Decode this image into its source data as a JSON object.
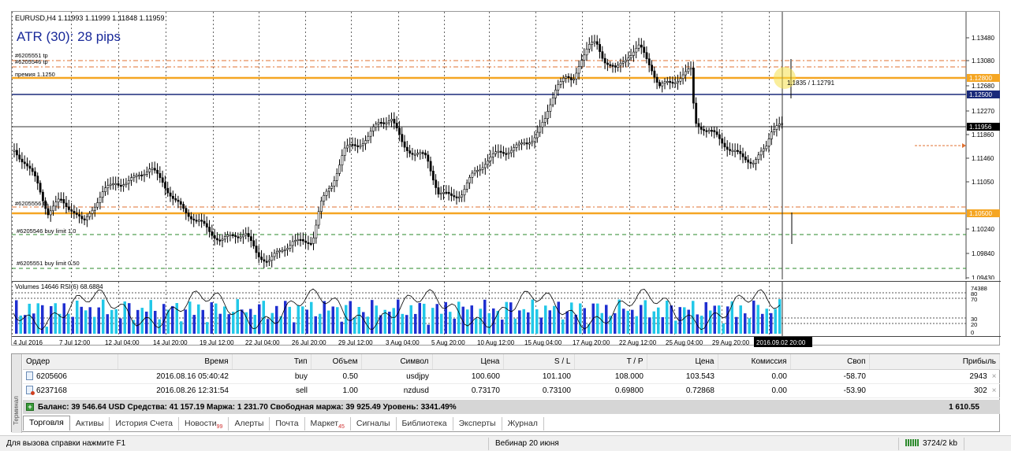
{
  "chart": {
    "header": "EURUSD,H4  1.11993 1.11999 1.11848 1.11959",
    "atr_label": "ATR (30): 28 pips",
    "volumes_header": "Volumes 14646  RSI(6) 68.6884",
    "current_price": "1.11956",
    "crosshair_label": "1.1835 / 1.12791",
    "time_marker": "2016.09.02 20:00",
    "price_ticks": [
      "1.13480",
      "1.13080",
      "1.12680",
      "1.12270",
      "1.11860",
      "1.11460",
      "1.11050",
      "1.10240",
      "1.09840",
      "1.09430"
    ],
    "highlighted_price_ticks": [
      {
        "value": "1.12800",
        "color": "#f5a623"
      },
      {
        "value": "1.12500",
        "color": "#1a2a7a"
      },
      {
        "value": "1.10500",
        "color": "#f5a623"
      }
    ],
    "order_labels": {
      "tp1": "#6205551 tp",
      "tp2": "#6205546 tp",
      "premium": "премия 1.1250",
      "tp3": "#6205556 tp",
      "buy_limit1": "#6205546 buy limit 1.0",
      "buy_limit2": "#6205551 buy limit 0.50"
    },
    "indicator_ticks": [
      "74388",
      "80",
      "70",
      "30",
      "20",
      "0"
    ],
    "time_labels": [
      "4 Jul 2016",
      "7 Jul 12:00",
      "12 Jul 04:00",
      "14 Jul 20:00",
      "19 Jul 12:00",
      "22 Jul 04:00",
      "26 Jul 20:00",
      "29 Jul 12:00",
      "3 Aug 04:00",
      "5 Aug 20:00",
      "10 Aug 12:00",
      "15 Aug 04:00",
      "17 Aug 20:00",
      "22 Aug 12:00",
      "25 Aug 04:00",
      "29 Aug 20:00"
    ],
    "colors": {
      "orange_line": "#f5a623",
      "navy_line": "#1a2a7a",
      "volume_blue": "#1f2fd0",
      "volume_cyan": "#22c8e8",
      "atr_text": "#1a2a9a"
    }
  },
  "terminal": {
    "side_label": "Терминал",
    "columns": [
      "Ордер",
      "Время",
      "Тип",
      "Объем",
      "Символ",
      "Цена",
      "S / L",
      "T / P",
      "Цена",
      "Комиссия",
      "Своп",
      "Прибыль"
    ],
    "rows": [
      {
        "order": "6205606",
        "time": "2016.08.16 05:40:42",
        "type": "buy",
        "volume": "0.50",
        "symbol": "usdjpy",
        "price": "100.600",
        "sl": "101.100",
        "tp": "108.000",
        "cur_price": "103.543",
        "commission": "0.00",
        "swap": "-58.70",
        "profit": "2943",
        "icon": "order-icon"
      },
      {
        "order": "6237168",
        "time": "2016.08.26 12:31:54",
        "type": "sell",
        "volume": "1.00",
        "symbol": "nzdusd",
        "price": "0.73170",
        "sl": "0.73100",
        "tp": "0.69800",
        "cur_price": "0.72868",
        "commission": "0.00",
        "swap": "-53.90",
        "profit": "302",
        "icon": "order-sell-icon"
      }
    ],
    "balance_text": "Баланс: 39 546.64 USD  Средства: 41 157.19  Маржа: 1 231.70  Свободная маржа: 39 925.49  Уровень: 3341.49%",
    "balance_total": "1 610.55",
    "close_symbol": "×",
    "tabs": [
      {
        "label": "Торговля",
        "badge": ""
      },
      {
        "label": "Активы",
        "badge": ""
      },
      {
        "label": "История Счета",
        "badge": ""
      },
      {
        "label": "Новости",
        "badge": "99"
      },
      {
        "label": "Алерты",
        "badge": ""
      },
      {
        "label": "Почта",
        "badge": ""
      },
      {
        "label": "Маркет",
        "badge": "45"
      },
      {
        "label": "Сигналы",
        "badge": ""
      },
      {
        "label": "Библиотека",
        "badge": ""
      },
      {
        "label": "Эксперты",
        "badge": ""
      },
      {
        "label": "Журнал",
        "badge": ""
      }
    ]
  },
  "status_bar": {
    "help": "Для вызова справки нажмите F1",
    "webinar": "Вебинар 20 июня",
    "traffic": "3724/2 kb"
  }
}
